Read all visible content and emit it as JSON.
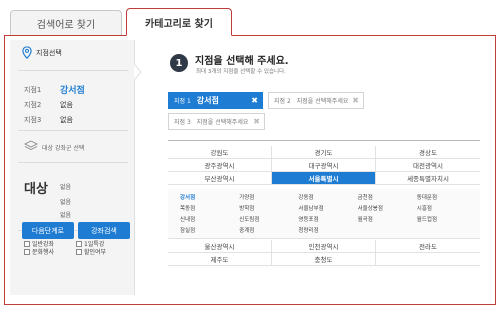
{
  "tabs": [
    {
      "label": "검색어로 찾기",
      "active": false
    },
    {
      "label": "카테고리로 찾기",
      "active": true
    }
  ],
  "left": {
    "branch_select_label": "지점선택",
    "branches": [
      {
        "label": "지점1",
        "value": "강서점"
      },
      {
        "label": "지점2",
        "value": "없음"
      },
      {
        "label": "지점3",
        "value": "없음"
      }
    ],
    "target_course_label": "대상 강좌군 선택",
    "target_title": "대상",
    "target_values": [
      "없음",
      "없음",
      "없음"
    ],
    "checkboxes": [
      "일반강좌",
      "1일특강",
      "문화행사",
      "할인여부"
    ],
    "next_button": "다음단계로",
    "search_button": "강좌검색"
  },
  "step": {
    "number": "1",
    "title": "지점을 선택해 주세요.",
    "subtitle": "최대 3개의 지점을 선택할 수 있습니다."
  },
  "chips": [
    {
      "label": "지점 1",
      "name": "강서점",
      "hint": "",
      "active": true
    },
    {
      "label": "지점 2",
      "name": "",
      "hint": "지점을 선택해주세요",
      "active": false
    },
    {
      "label": "지점 3",
      "name": "",
      "hint": "지점을 선택해주세요",
      "active": false
    }
  ],
  "regions_top": [
    "강원도",
    "경기도",
    "경상도",
    "광주광역시",
    "대구광역시",
    "대전광역시",
    "부산광역시",
    "서울특별시",
    "세종특별자치시"
  ],
  "selected_region": "서울특별시",
  "seoul_branches": [
    "강서점",
    "가양점",
    "강동점",
    "금천점",
    "동대문점",
    "목동점",
    "방학점",
    "서울남부점",
    "서울상봉점",
    "시흥점",
    "신내점",
    "신도림점",
    "영등포점",
    "월곡점",
    "월드컵점",
    "잠실점",
    "중계점",
    "청량리점"
  ],
  "selected_branch": "강서점",
  "regions_bottom": [
    "울산광역시",
    "인천광역시",
    "전라도",
    "제주도",
    "충청도",
    ""
  ],
  "colors": {
    "accent": "#1e7cd3",
    "frame_border": "#c23b3b",
    "step_circle": "#2f3a46"
  }
}
